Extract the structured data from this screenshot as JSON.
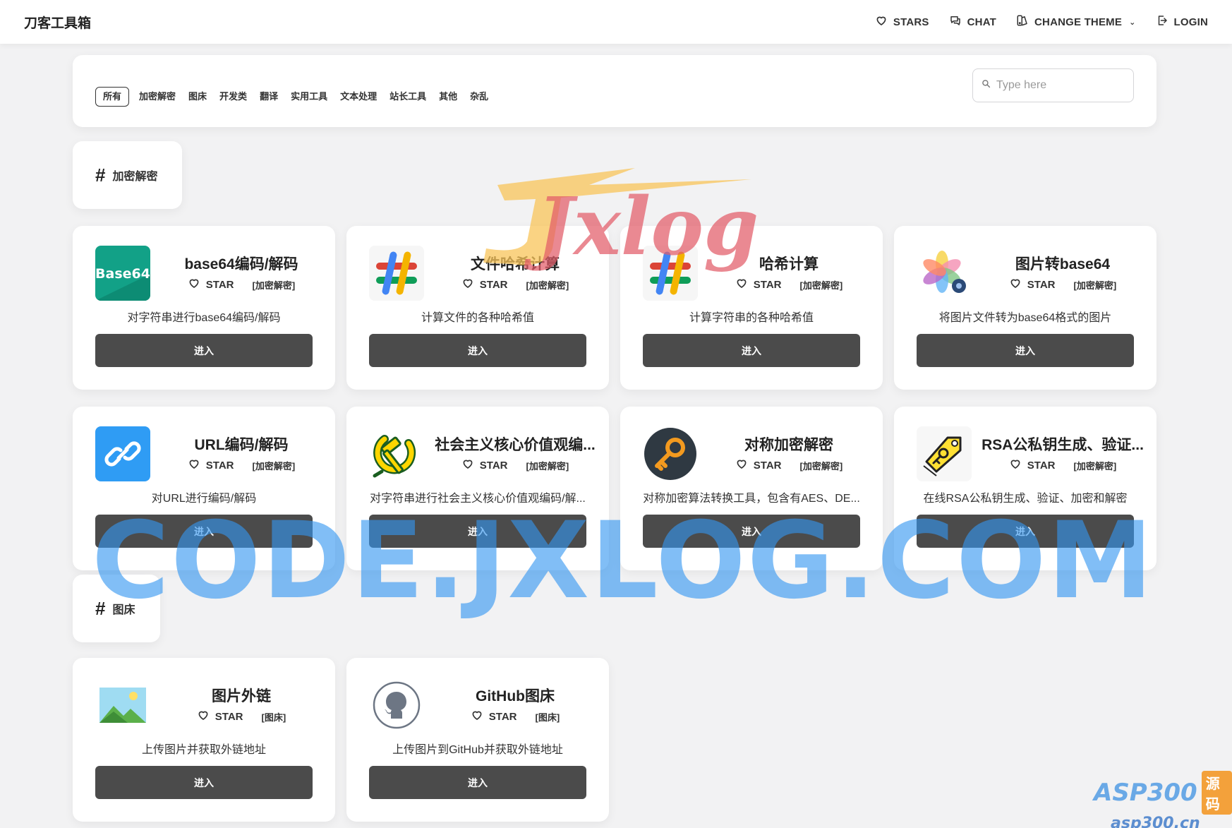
{
  "nav": {
    "brand": "刀客工具箱",
    "stars": "STARS",
    "chat": "CHAT",
    "change_theme": "CHANGE THEME",
    "login": "LOGIN"
  },
  "filter": {
    "tabs": [
      "所有",
      "加密解密",
      "图床",
      "开发类",
      "翻译",
      "实用工具",
      "文本处理",
      "站长工具",
      "其他",
      "杂乱"
    ],
    "active_tab": "所有",
    "search_placeholder": "Type here"
  },
  "sections": [
    {
      "hash": "#",
      "label": "加密解密",
      "tools": [
        {
          "title": "base64编码/解码",
          "star": "STAR",
          "tag": "[加密解密]",
          "desc": "对字符串进行base64编码/解码",
          "button": "进入",
          "icon": "base64-icon"
        },
        {
          "title": "文件哈希计算",
          "star": "STAR",
          "tag": "[加密解密]",
          "desc": "计算文件的各种哈希值",
          "button": "进入",
          "icon": "hash-icon"
        },
        {
          "title": "哈希计算",
          "star": "STAR",
          "tag": "[加密解密]",
          "desc": "计算字符串的各种哈希值",
          "button": "进入",
          "icon": "hash-icon"
        },
        {
          "title": "图片转base64",
          "star": "STAR",
          "tag": "[加密解密]",
          "desc": "将图片文件转为base64格式的图片",
          "button": "进入",
          "icon": "photos-icon"
        },
        {
          "title": "URL编码/解码",
          "star": "STAR",
          "tag": "[加密解密]",
          "desc": "对URL进行编码/解码",
          "button": "进入",
          "icon": "link-icon"
        },
        {
          "title": "社会主义核心价值观编...",
          "star": "STAR",
          "tag": "[加密解密]",
          "desc": "对字符串进行社会主义核心价值观编码/解...",
          "button": "进入",
          "icon": "hammer-sickle-icon"
        },
        {
          "title": "对称加密解密",
          "star": "STAR",
          "tag": "[加密解密]",
          "desc": "对称加密算法转换工具，包含有AES、DE...",
          "button": "进入",
          "icon": "key-icon"
        },
        {
          "title": "RSA公私钥生成、验证...",
          "star": "STAR",
          "tag": "[加密解密]",
          "desc": "在线RSA公私钥生成、验证、加密和解密",
          "button": "进入",
          "icon": "key-tag-icon"
        }
      ]
    },
    {
      "hash": "#",
      "label": "图床",
      "tools": [
        {
          "title": "图片外链",
          "star": "STAR",
          "tag": "[图床]",
          "desc": "上传图片并获取外链地址",
          "button": "进入",
          "icon": "landscape-icon"
        },
        {
          "title": "GitHub图床",
          "star": "STAR",
          "tag": "[图床]",
          "desc": "上传图片到GitHub并获取外链地址",
          "button": "进入",
          "icon": "github-icon"
        }
      ]
    }
  ],
  "watermarks": {
    "center": "CODE.JXLOG.COM",
    "logo": "Jxlog",
    "corner_top": "ASP300",
    "corner_badge": "源码",
    "corner_bottom": "asp300.cn"
  }
}
